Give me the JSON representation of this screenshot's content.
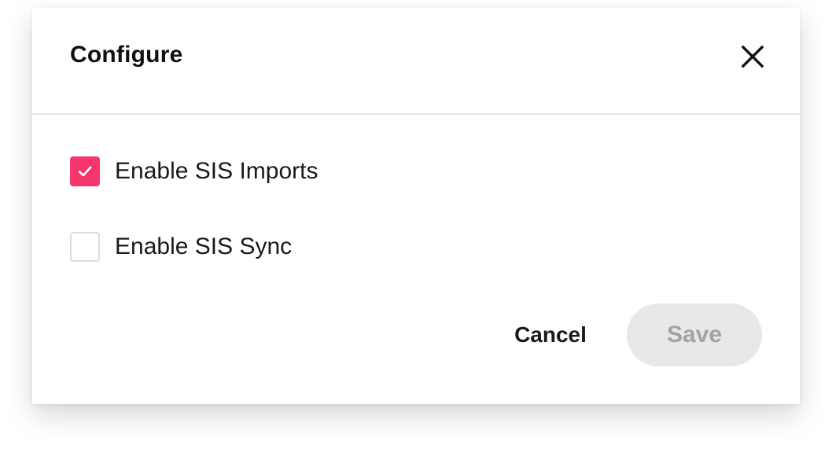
{
  "dialog": {
    "title": "Configure",
    "close_icon": "close-icon"
  },
  "options": [
    {
      "label": "Enable SIS Imports",
      "checked": true
    },
    {
      "label": "Enable SIS Sync",
      "checked": false
    }
  ],
  "footer": {
    "cancel_label": "Cancel",
    "save_label": "Save",
    "save_disabled": true
  },
  "colors": {
    "accent": "#f5356c",
    "save_disabled_bg": "#e8e8e8",
    "save_disabled_text": "#a3a3a3"
  }
}
